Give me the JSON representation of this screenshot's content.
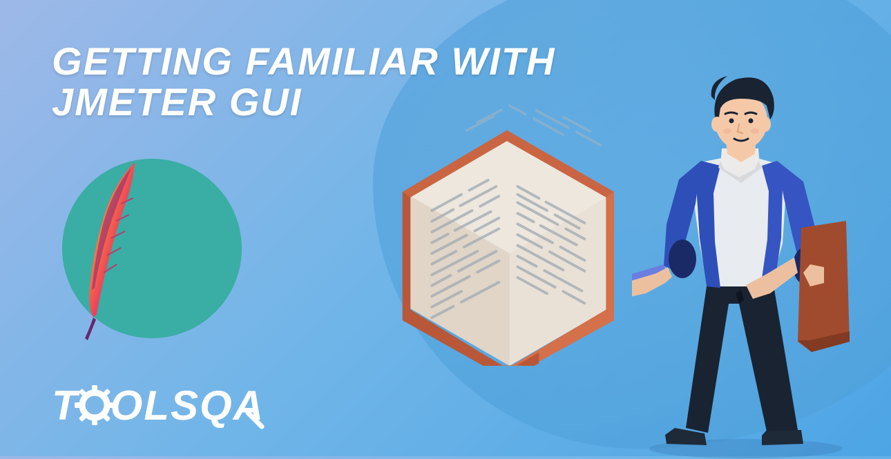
{
  "heading_line1": "GETTING FAMILIAR WITH",
  "heading_line2": "JMETER GUI",
  "logo_prefix": "T",
  "logo_suffix": "OLSQA"
}
